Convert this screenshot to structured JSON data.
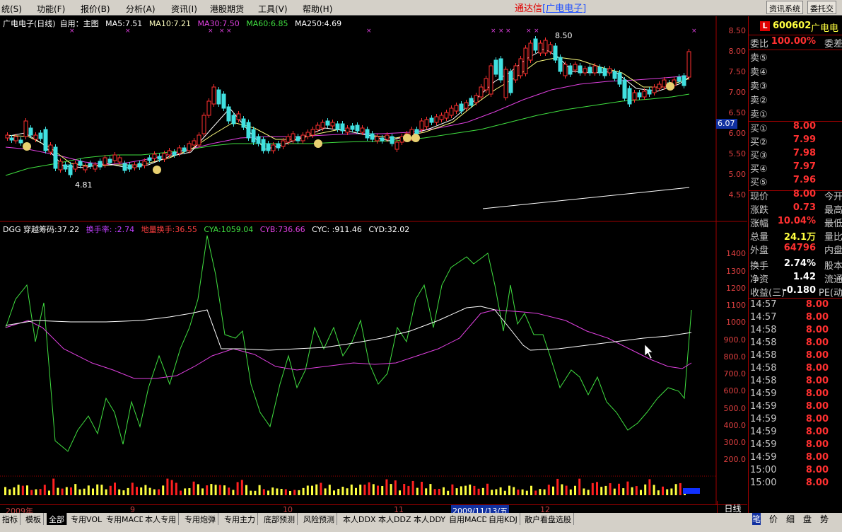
{
  "menubar": {
    "items": [
      "统(S)",
      "功能(F)",
      "报价(B)",
      "分析(A)",
      "资讯(I)",
      "港股期货",
      "工具(V)",
      "帮助(H)"
    ],
    "app_title": "通达信",
    "app_subtitle": "[广电电子]",
    "sys_buttons": [
      "资讯系统",
      "委托交"
    ]
  },
  "main_chart": {
    "title": "广电电子(日线)",
    "mode": "自用：主图",
    "ma_labels": [
      {
        "text": "MA5:7.51",
        "color": "#ffffff"
      },
      {
        "text": "MA10:7.21",
        "color": "#ffffc0"
      },
      {
        "text": "MA30:7.50",
        "color": "#e040e0"
      },
      {
        "text": "MA60:6.85",
        "color": "#40e040"
      },
      {
        "text": "MA250:4.69",
        "color": "#ffffff"
      }
    ],
    "y_ticks": [
      "8.50",
      "8.00",
      "7.50",
      "7.00",
      "6.50",
      "6.00",
      "5.50",
      "5.00",
      "4.50"
    ],
    "current_price_tag": "6.07",
    "high_label": "8.50",
    "low_label": "4.81"
  },
  "indicator_chart": {
    "labels": [
      {
        "text": "DGG 穿越筹码:37.22",
        "color": "#ffffff"
      },
      {
        "text": "换手率: :2.74",
        "color": "#c040ff"
      },
      {
        "text": "地量换手:36.55",
        "color": "#ff4040"
      },
      {
        "text": "CYA:1059.04",
        "color": "#40e040"
      },
      {
        "text": "CYB:736.66",
        "color": "#e040e0"
      },
      {
        "text": "CYC: :911.46",
        "color": "#ffffff"
      },
      {
        "text": "CYD:32.02",
        "color": "#ffffff"
      }
    ],
    "y_ticks": [
      "1400",
      "1300",
      "1200",
      "1100",
      "1000",
      "900.0",
      "800.0",
      "700.0",
      "600.0",
      "500.0",
      "400.0",
      "300.0",
      "200.0"
    ]
  },
  "date_bar": {
    "labels": [
      {
        "text": "2009年",
        "pos": "start"
      },
      {
        "text": "9",
        "pos": "m9"
      },
      {
        "text": "10",
        "pos": "m10"
      },
      {
        "text": "11",
        "pos": "m11"
      },
      {
        "text": "12",
        "pos": "m12"
      }
    ],
    "highlight": "2009/11/13/五",
    "period": "日线"
  },
  "tabs": [
    "指标",
    "模板",
    "全部",
    "专用VOL",
    "专用MACD",
    "本人专用",
    "专用炮弹",
    "专用主力",
    "底部预测",
    "风险预测",
    "本人DDX",
    "本人DDZ",
    "本人DDY",
    "自用MACD",
    "自用KDJ",
    "散户看盘选股"
  ],
  "active_tab": "全部",
  "quote": {
    "code": "600602",
    "name": "广电电",
    "weibi_label": "委比",
    "weibi_value": "100.00%",
    "weicha_label": "委差",
    "sell": [
      {
        "label": "卖⑤",
        "price": ""
      },
      {
        "label": "卖④",
        "price": ""
      },
      {
        "label": "卖③",
        "price": ""
      },
      {
        "label": "卖②",
        "price": ""
      },
      {
        "label": "卖①",
        "price": ""
      }
    ],
    "buy": [
      {
        "label": "买①",
        "price": "8.00"
      },
      {
        "label": "买②",
        "price": "7.99"
      },
      {
        "label": "买③",
        "price": "7.98"
      },
      {
        "label": "买④",
        "price": "7.97"
      },
      {
        "label": "买⑤",
        "price": "7.96"
      }
    ],
    "stats": [
      {
        "label": "现价",
        "value": "8.00",
        "color": "#ff3030",
        "label2": "今开"
      },
      {
        "label": "涨跌",
        "value": "0.73",
        "color": "#ff3030",
        "label2": "最高"
      },
      {
        "label": "涨幅",
        "value": "10.04%",
        "color": "#ff3030",
        "label2": "最低"
      },
      {
        "label": "总量",
        "value": "24.1万",
        "color": "#ffff40",
        "label2": "量比"
      },
      {
        "label": "外盘",
        "value": "64796",
        "color": "#ff3030",
        "label2": "内盘"
      },
      {
        "label": "换手",
        "value": "2.74%",
        "color": "#ffffff",
        "label2": "股本"
      },
      {
        "label": "净资",
        "value": "1.42",
        "color": "#ffffff",
        "label2": "流通"
      },
      {
        "label": "收益(三)",
        "value": "-0.180",
        "color": "#ffffff",
        "label2": "PE(动"
      }
    ],
    "ticks": [
      {
        "time": "14:57",
        "price": "8.00"
      },
      {
        "time": "14:57",
        "price": "8.00"
      },
      {
        "time": "14:58",
        "price": "8.00"
      },
      {
        "time": "14:58",
        "price": "8.00"
      },
      {
        "time": "14:58",
        "price": "8.00"
      },
      {
        "time": "14:58",
        "price": "8.00"
      },
      {
        "time": "14:58",
        "price": "8.00"
      },
      {
        "time": "14:59",
        "price": "8.00"
      },
      {
        "time": "14:59",
        "price": "8.00"
      },
      {
        "time": "14:59",
        "price": "8.00"
      },
      {
        "time": "14:59",
        "price": "8.00"
      },
      {
        "time": "14:59",
        "price": "8.00"
      },
      {
        "time": "14:59",
        "price": "8.00"
      },
      {
        "time": "15:00",
        "price": "8.00"
      },
      {
        "time": "15:00",
        "price": "8.00"
      }
    ],
    "side_tabs": [
      "笔",
      "价",
      "细",
      "盘",
      "势"
    ]
  },
  "colors": {
    "up": "#ff3030",
    "down": "#40e0e0",
    "grid": "#a00000",
    "ma5": "#ffffff",
    "ma10": "#ffff80",
    "ma30": "#e040e0",
    "ma60": "#40e040"
  }
}
